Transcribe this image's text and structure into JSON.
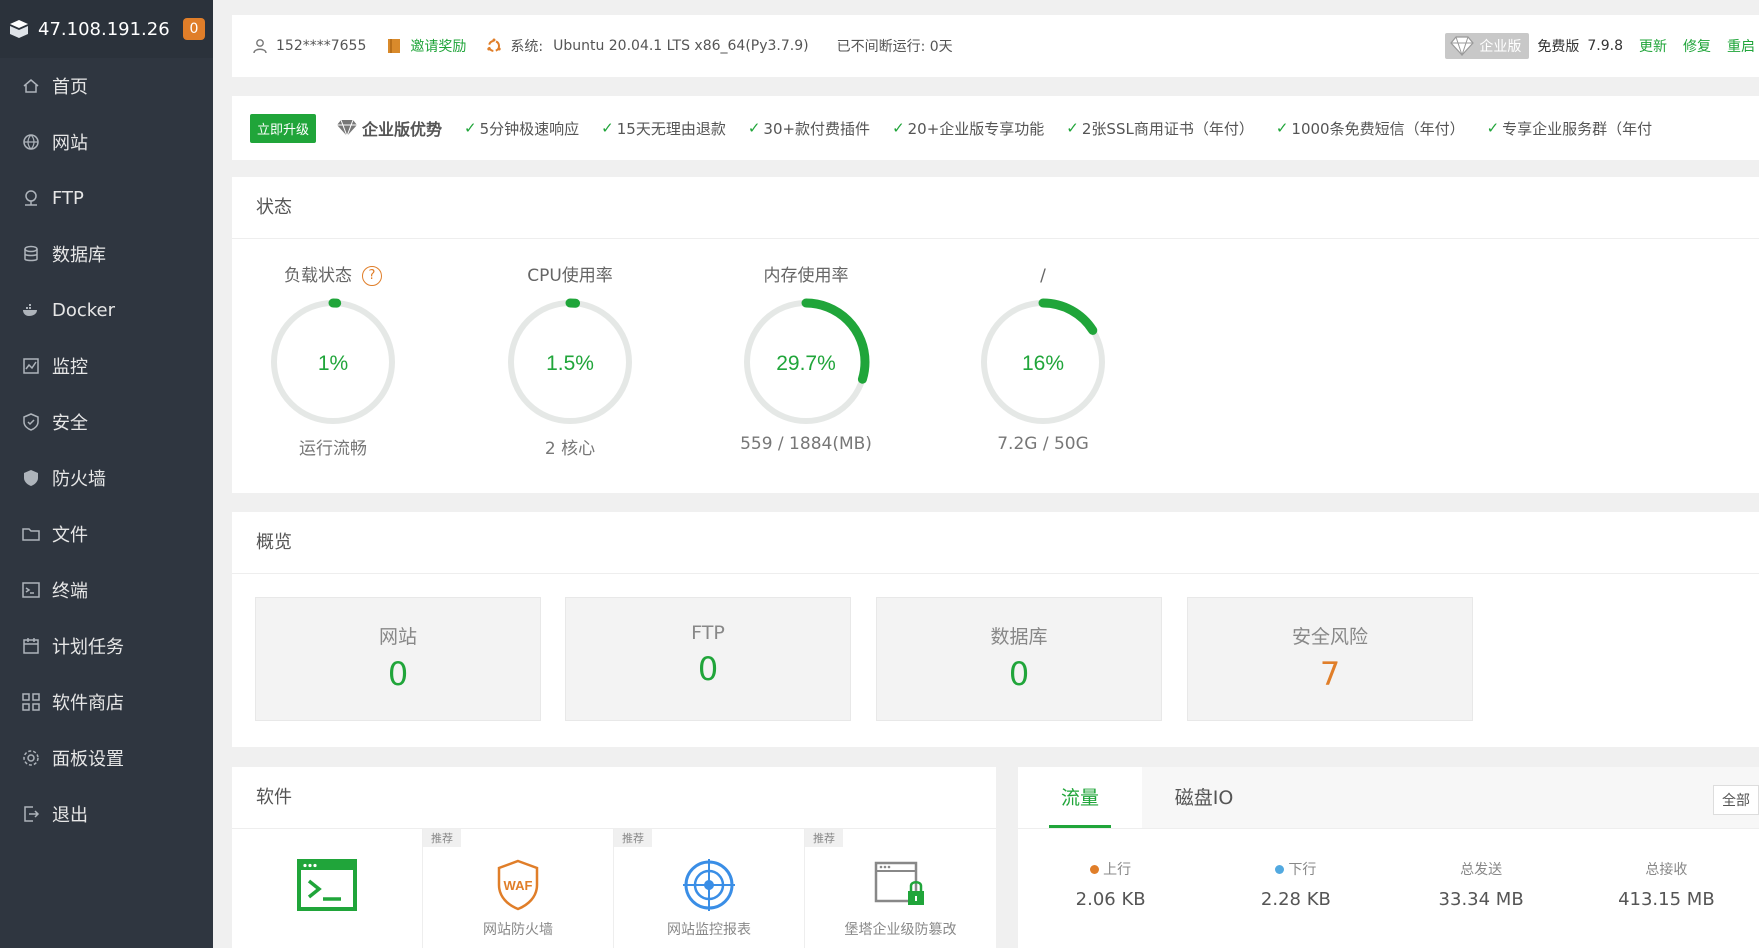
{
  "sidebar": {
    "ip": "47.108.191.26",
    "badge": "0",
    "items": [
      {
        "label": "首页",
        "icon": "home-icon"
      },
      {
        "label": "网站",
        "icon": "globe-icon"
      },
      {
        "label": "FTP",
        "icon": "ftp-icon"
      },
      {
        "label": "数据库",
        "icon": "database-icon"
      },
      {
        "label": "Docker",
        "icon": "docker-icon"
      },
      {
        "label": "监控",
        "icon": "monitor-icon"
      },
      {
        "label": "安全",
        "icon": "shield-check-icon"
      },
      {
        "label": "防火墙",
        "icon": "firewall-icon"
      },
      {
        "label": "文件",
        "icon": "folder-icon"
      },
      {
        "label": "终端",
        "icon": "terminal-icon"
      },
      {
        "label": "计划任务",
        "icon": "calendar-icon"
      },
      {
        "label": "软件商店",
        "icon": "apps-icon"
      },
      {
        "label": "面板设置",
        "icon": "gear-icon"
      },
      {
        "label": "退出",
        "icon": "logout-icon"
      }
    ]
  },
  "topbar": {
    "user": "152****7655",
    "invite": "邀请奖励",
    "system_label": "系统:",
    "system_value": "Ubuntu 20.04.1 LTS x86_64(Py3.7.9)",
    "uptime": "已不间断运行: 0天",
    "enterprise": "企业版",
    "edition": "免费版",
    "version": "7.9.8",
    "update": "更新",
    "repair": "修复",
    "restart": "重启"
  },
  "upgrade": {
    "button": "立即升级",
    "title": "企业版优势",
    "features": [
      "5分钟极速响应",
      "15天无理由退款",
      "30+款付费插件",
      "20+企业版专享功能",
      "2张SSL商用证书（年付）",
      "1000条免费短信（年付）",
      "专享企业服务群（年付"
    ]
  },
  "status": {
    "title": "状态",
    "gauges": [
      {
        "title": "负载状态",
        "value": "1%",
        "percent": 1,
        "sub": "运行流畅",
        "help": "?"
      },
      {
        "title": "CPU使用率",
        "value": "1.5%",
        "percent": 1.5,
        "sub": "2 核心"
      },
      {
        "title": "内存使用率",
        "value": "29.7%",
        "percent": 29.7,
        "sub": "559 / 1884(MB)"
      },
      {
        "title": "/",
        "value": "16%",
        "percent": 16,
        "sub": "7.2G / 50G"
      }
    ]
  },
  "overview": {
    "title": "概览",
    "boxes": [
      {
        "label": "网站",
        "value": "0"
      },
      {
        "label": "FTP",
        "value": "0"
      },
      {
        "label": "数据库",
        "value": "0"
      },
      {
        "label": "安全风险",
        "value": "7"
      }
    ]
  },
  "software": {
    "title": "软件",
    "items": [
      {
        "name": "",
        "recommend": ""
      },
      {
        "name": "网站防火墙",
        "recommend": "推荐"
      },
      {
        "name": "网站监控报表",
        "recommend": "推荐"
      },
      {
        "name": "堡塔企业级防篡改",
        "recommend": "推荐"
      }
    ]
  },
  "traffic": {
    "tabs": [
      "流量",
      "磁盘IO"
    ],
    "select": "全部",
    "stats": [
      {
        "label": "上行",
        "value": "2.06 KB",
        "dot": "#e07e29"
      },
      {
        "label": "下行",
        "value": "2.28 KB",
        "dot": "#52a9e0"
      },
      {
        "label": "总发送",
        "value": "33.34 MB"
      },
      {
        "label": "总接收",
        "value": "413.15 MB"
      }
    ]
  },
  "colors": {
    "accent": "#20a53a",
    "warning": "#e07e29",
    "sidebar": "#2f3640"
  }
}
